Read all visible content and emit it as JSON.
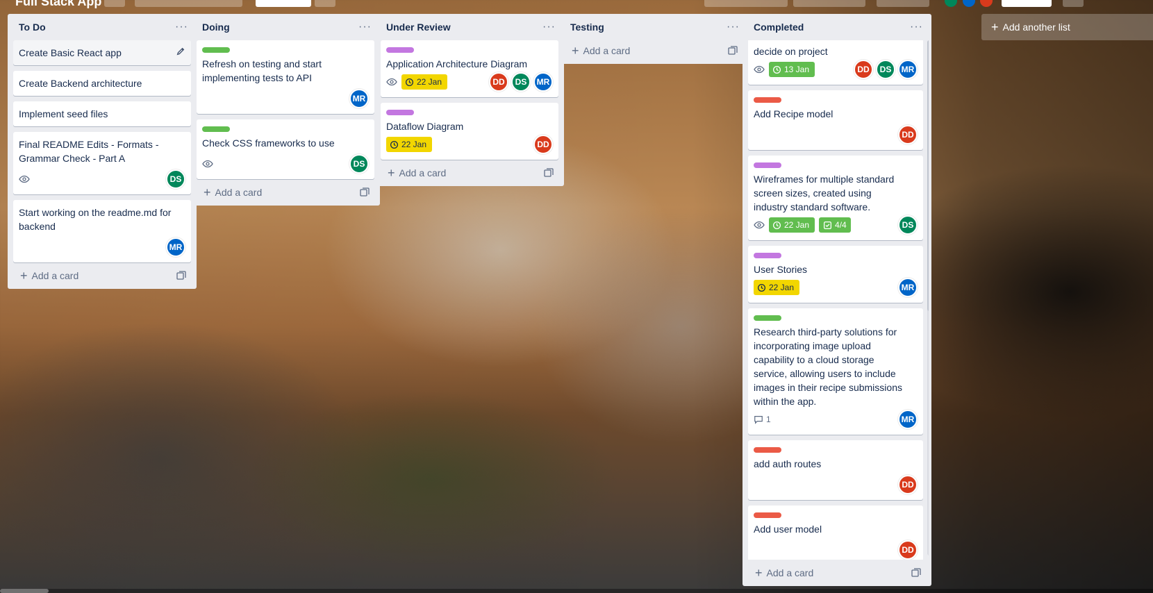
{
  "board": {
    "title": "Full Stack App"
  },
  "lists": {
    "todo": {
      "title": "To Do",
      "add_label": "Add a card",
      "cards": {
        "c1": {
          "title": "Create Basic React app"
        },
        "c2": {
          "title": "Create Backend architecture"
        },
        "c3": {
          "title": "Implement seed files"
        },
        "c4": {
          "title": "Final README Edits - Formats - Grammar Check - Part A",
          "members": [
            "DS"
          ]
        },
        "c5": {
          "title": "Start working on the readme.md for backend",
          "members": [
            "MR"
          ]
        }
      }
    },
    "doing": {
      "title": "Doing",
      "add_label": "Add a card",
      "cards": {
        "c1": {
          "label": "green",
          "title": "Refresh on testing and start implementing tests to API",
          "members": [
            "MR"
          ]
        },
        "c2": {
          "label": "green",
          "title": "Check CSS frameworks to use",
          "members": [
            "DS"
          ]
        }
      }
    },
    "review": {
      "title": "Under Review",
      "add_label": "Add a card",
      "cards": {
        "c1": {
          "label": "purple",
          "title": "Application Architecture Diagram",
          "due": "22 Jan",
          "members": [
            "DD",
            "DS",
            "MR"
          ]
        },
        "c2": {
          "label": "purple",
          "title": "Dataflow Diagram",
          "due": "22 Jan",
          "members": [
            "DD"
          ]
        }
      }
    },
    "testing": {
      "title": "Testing",
      "add_label": "Add a card"
    },
    "completed": {
      "title": "Completed",
      "add_label": "Add a card",
      "cards": {
        "c1": {
          "title": "decide on project",
          "due": "13 Jan",
          "members": [
            "DD",
            "DS",
            "MR"
          ]
        },
        "c2": {
          "label": "red",
          "title": "Add Recipe model",
          "members": [
            "DD"
          ]
        },
        "c3": {
          "label": "purple",
          "title": "Wireframes for multiple standard screen sizes, created using industry standard software.",
          "due": "22 Jan",
          "checklist": "4/4",
          "members": [
            "DS"
          ]
        },
        "c4": {
          "label": "purple",
          "title": "User Stories",
          "due": "22 Jan",
          "members": [
            "MR"
          ]
        },
        "c5": {
          "label": "green",
          "title": "Research third-party solutions for incorporating image upload capability to a cloud storage service, allowing users to include images in their recipe submissions within the app.",
          "comments": "1",
          "members": [
            "MR"
          ]
        },
        "c6": {
          "label": "red",
          "title": "add auth routes",
          "members": [
            "DD"
          ]
        },
        "c7": {
          "label": "red",
          "title": "Add user model",
          "members": [
            "DD"
          ]
        }
      }
    }
  },
  "add_list_label": "Add another list",
  "member_initials": {
    "mr": "MR",
    "ds": "DS",
    "dd": "DD"
  },
  "colors": {
    "label_green": "#61bd4f",
    "label_purple": "#c377e0",
    "label_red": "#eb5a46",
    "due_yellow": "#f2d600",
    "due_green": "#61bd4f",
    "avatar_mr": "#0065c8",
    "avatar_ds": "#00875a",
    "avatar_dd": "#d93a1c",
    "list_bg": "#ebecf0"
  },
  "icons": [
    "eye-icon",
    "clock-icon",
    "checklist-icon",
    "comment-icon",
    "pencil-icon",
    "plus-icon",
    "card-template-icon",
    "ellipsis-icon"
  ]
}
